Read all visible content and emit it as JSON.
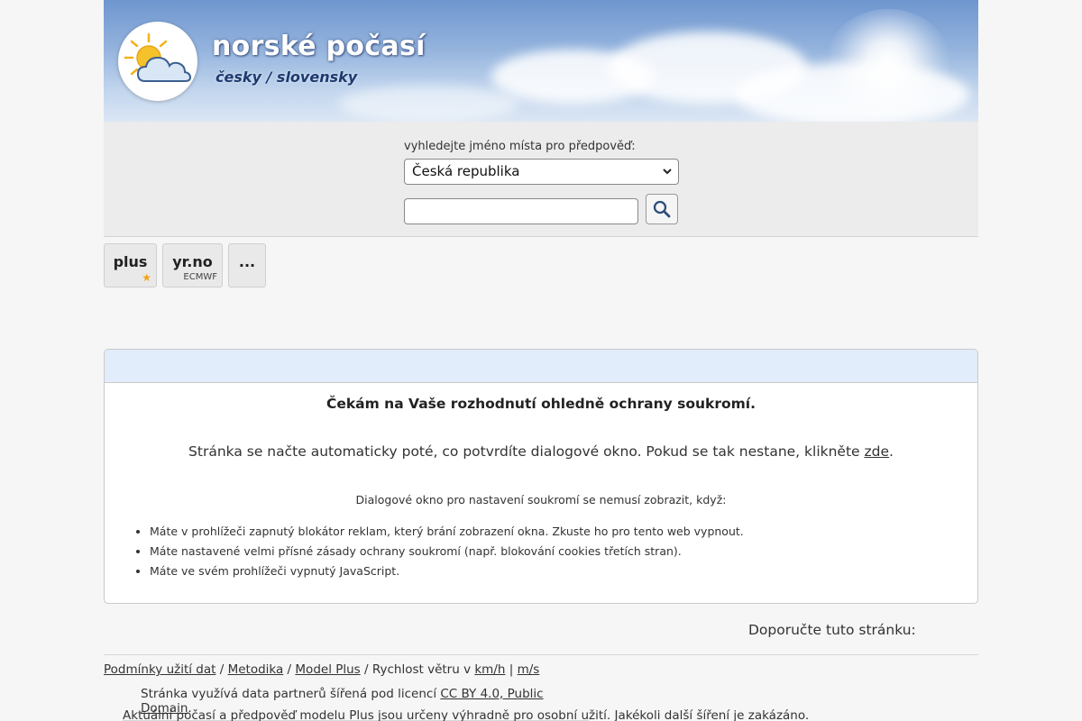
{
  "header": {
    "title": "norské počasí",
    "subtitle": "česky / slovensky"
  },
  "search": {
    "label": "vyhledejte jméno místa pro předpověď:",
    "country_selected": "Česká republika",
    "place_value": "",
    "button_icon": "search-icon"
  },
  "tabs": [
    {
      "label": "plus",
      "badge_icon": "star-icon"
    },
    {
      "label": "yr.no",
      "sub": "ECMWF"
    },
    {
      "label": "..."
    }
  ],
  "privacy": {
    "title": "Čekám na Vaše rozhodnutí ohledně ochrany soukromí.",
    "message": "Stránka se načte automaticky poté, co potvrdíte dialogové okno. Pokud se tak nestane, klikněte",
    "link": "zde",
    "message_end": ".",
    "info": "Dialogové okno pro nastavení soukromí se nemusí zobrazit, když:",
    "reasons": [
      "Máte v prohlížeči zapnutý blokátor reklam, který brání zobrazení okna. Zkuste ho pro tento web vypnout.",
      "Máte nastavené velmi přísné zásady ochrany soukromí (např. blokování cookies třetích stran).",
      "Máte ve svém prohlížeči vypnutý JavaScript."
    ]
  },
  "footer": {
    "recommend": "Doporučte tuto stránku:",
    "links": {
      "terms": "Podmínky užití dat",
      "sep1": " / ",
      "method": "Metodika",
      "sep2": " / ",
      "model": "Model Plus",
      "wind_label": " / Rychlost větru v ",
      "kmh": "km/h",
      "pipe": " | ",
      "ms": "m/s"
    },
    "license_text": "Stránka využívá data partnerů šířená pod licencí ",
    "license_link": "CC BY 4.0, Public Domain",
    "license_end": ".",
    "notice": "Aktuální počasí a předpověď modelu Plus jsou určeny výhradně pro osobní užití. Jakékoli další šíření je zakázáno."
  },
  "colors": {
    "header_sky": "#6f96cf",
    "box_head": "#e2edfb",
    "star": "#f2a31b"
  }
}
